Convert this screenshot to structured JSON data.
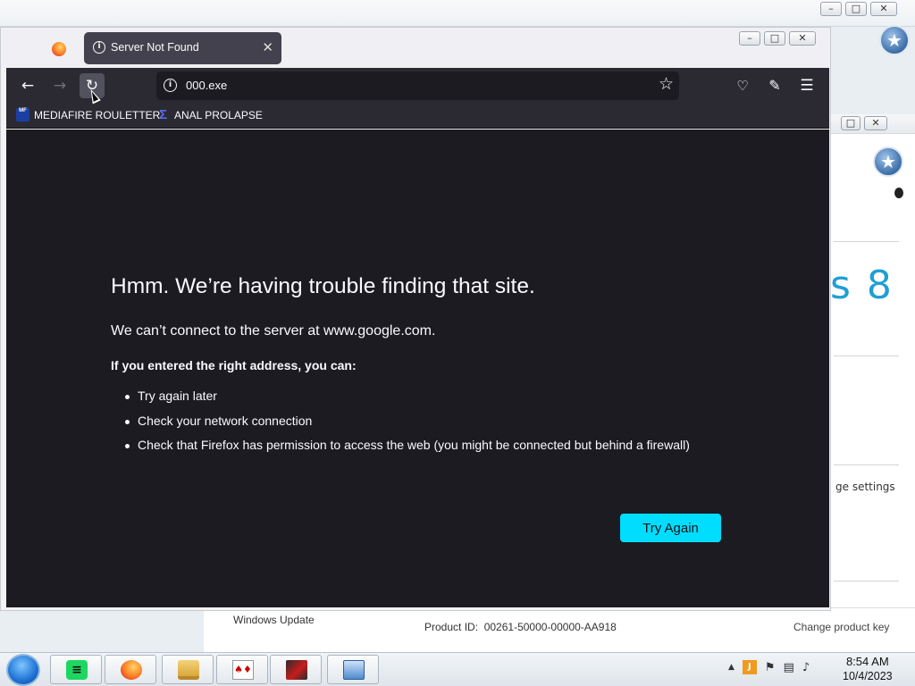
{
  "browser": {
    "tab": {
      "title": "Server Not Found"
    },
    "url": "000.exe",
    "bookmarks": [
      {
        "label": "MEDIAFIRE ROULETTER",
        "icon": "mediafire-icon",
        "icon_text": "MF"
      },
      {
        "label": "ANAL PROLAPSE",
        "icon": "sigma-icon"
      }
    ]
  },
  "error_page": {
    "title": "Hmm. We’re having trouble finding that site.",
    "description": "We can’t connect to the server at www.google.com.",
    "subtitle": "If you entered the right address, you can:",
    "suggestions": [
      "Try again later",
      "Check your network connection",
      "Check that Firefox has permission to access the web (you might be connected but behind a firewall)"
    ],
    "button_label": "Try Again"
  },
  "background_window": {
    "logo_text": "s 8",
    "settings_text": "ge settings"
  },
  "system_bar": {
    "windows_update": "Windows Update",
    "product_id_label": "Product ID:",
    "product_id": "00261-50000-00000-AA918",
    "change_product_key": "Change product key"
  },
  "taskbar": {
    "time": "8:54 AM",
    "date": "10/4/2023",
    "items": [
      "spotify-icon",
      "firefox-icon",
      "file-explorer-icon",
      "solitaire-icon",
      "red-app-icon",
      "computer-icon"
    ]
  },
  "colors": {
    "accent": "#00ddff",
    "page_bg": "#1c1b22",
    "toolbar_bg": "#2b2a33"
  }
}
